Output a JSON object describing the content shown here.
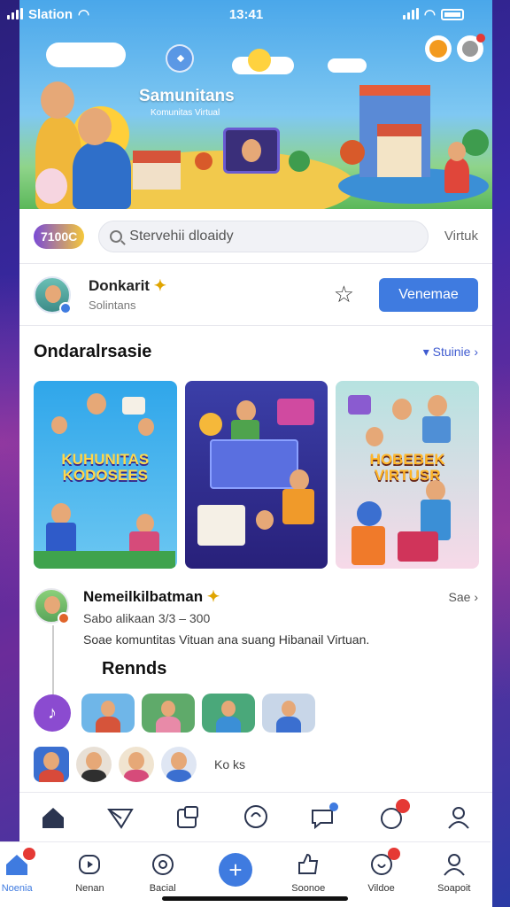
{
  "status_bar": {
    "carrier": "Slation",
    "time": "13:41"
  },
  "hero": {
    "title": "Samunitans",
    "subtitle": "Komunitas Virtual"
  },
  "search": {
    "coins": "7100C",
    "placeholder": "Stervehii dloaidy",
    "right_label": "Virtuk"
  },
  "profile": {
    "name": "Donkarit",
    "sub": "Solintans",
    "action_label": "Venemae"
  },
  "section": {
    "title": "Ondaralrsasie",
    "link": "Stuinie"
  },
  "cards": [
    {
      "title": "KUHUNITAS KODOSEES"
    },
    {
      "title": ""
    },
    {
      "title": "HOBEBEK VIRTUSR"
    }
  ],
  "feed": {
    "name": "Nemeilkilbatman",
    "see": "Sae",
    "meta": "Sabo alikaan 3/3 – 300",
    "desc": "Soae komuntitas Vituan ana suang Hibanail Virtuan."
  },
  "friends": {
    "title": "Rennds",
    "count": "Ko ks"
  },
  "nav_top": [
    {
      "icon": "home-icon"
    },
    {
      "icon": "send-icon"
    },
    {
      "icon": "gallery-icon"
    },
    {
      "icon": "chat-icon"
    },
    {
      "icon": "message-icon"
    },
    {
      "icon": "notification-icon"
    },
    {
      "icon": "profile-icon"
    }
  ],
  "bottom_nav": [
    {
      "label": "Noenia",
      "icon": "home-icon",
      "badge": true
    },
    {
      "label": "Nenan",
      "icon": "video-icon",
      "badge": false
    },
    {
      "label": "Bacial",
      "icon": "chat-icon",
      "badge": false
    },
    {
      "label": "",
      "icon": "plus-icon",
      "badge": false
    },
    {
      "label": "Soonoe",
      "icon": "like-icon",
      "badge": false
    },
    {
      "label": "Vildoe",
      "icon": "notification-icon",
      "badge": true
    },
    {
      "label": "Soapoit",
      "icon": "profile-icon",
      "badge": false
    }
  ],
  "colors": {
    "accent": "#3f7be0",
    "badge": "#e53935"
  }
}
